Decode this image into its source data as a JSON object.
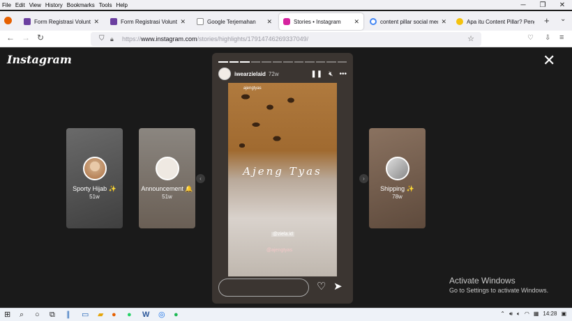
{
  "menu": [
    "File",
    "Edit",
    "View",
    "History",
    "Bookmarks",
    "Tools",
    "Help"
  ],
  "window_controls": [
    "─",
    "❐",
    "✕"
  ],
  "tabs": [
    {
      "label": "Form Registrasi Volunteer Jak",
      "icon": "form-icon",
      "color": "#6b3fa0"
    },
    {
      "label": "Form Registrasi Volunteer Jak",
      "icon": "form-icon",
      "color": "#6b3fa0"
    },
    {
      "label": "Google Terjemahan",
      "icon": "page-icon",
      "color": "#888888"
    },
    {
      "label": "Stories • Instagram",
      "icon": "instagram-icon",
      "color": "#d6249f",
      "active": true
    },
    {
      "label": "content pillar social media -",
      "icon": "google-icon",
      "color": "#4285f4"
    },
    {
      "label": "Apa itu Content Pillar? Peng",
      "icon": "emoji-icon",
      "color": "#f4c20d"
    }
  ],
  "url": {
    "prefix": "https://",
    "host": "www.instagram.com",
    "path": "/stories/highlights/17914746269337049/"
  },
  "page": {
    "logo": "Instagram",
    "close": "✕"
  },
  "highlights_left": [
    {
      "title": "Sporty Hijab ✨",
      "age": "51w",
      "bg": "#5a5a5a"
    },
    {
      "title": "Announcement 🔔",
      "age": "51w",
      "bg": "#7a7068"
    }
  ],
  "highlights_right": [
    {
      "title": "Shipping ✨",
      "age": "78w",
      "bg": "#6e5a4c"
    }
  ],
  "story": {
    "username": "iwearzielaid",
    "time": "72w",
    "progress_total": 12,
    "progress_done": 3,
    "media_brand": "ajengtyas",
    "media_script": "Ajeng Tyas",
    "tag1": "@ziela.id",
    "tag2": "@ajengtyas"
  },
  "watermark": {
    "line1": "Activate Windows",
    "line2": "Go to Settings to activate Windows."
  },
  "taskbar": {
    "clock": "14:28"
  }
}
